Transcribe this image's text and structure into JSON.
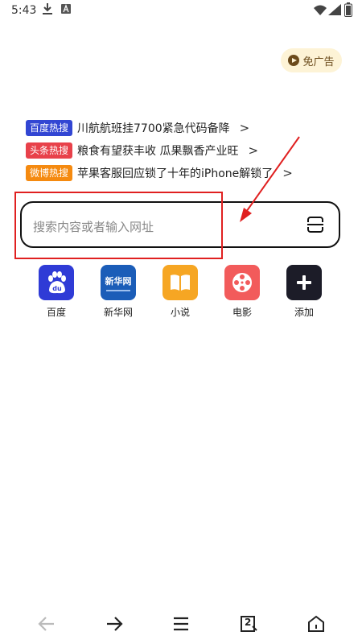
{
  "status_bar": {
    "time": "5:43"
  },
  "ad_free_button": {
    "label": "免广告"
  },
  "hot_searches": [
    {
      "tag": "百度热搜",
      "tag_color": "#3246d3",
      "text": "川航航班挂7700紧急代码备降"
    },
    {
      "tag": "头条热搜",
      "tag_color": "#e8414a",
      "text": "粮食有望获丰收 瓜果飘香产业旺"
    },
    {
      "tag": "微博热搜",
      "tag_color": "#f58a10",
      "text": "苹果客服回应锁了十年的iPhone解锁了"
    }
  ],
  "search": {
    "placeholder": "搜索内容或者输入网址"
  },
  "shortcuts": [
    {
      "label": "百度",
      "icon": "baidu-paw-icon",
      "color": "#2f3bd6"
    },
    {
      "label": "新华网",
      "icon": "xinhua-logo-icon",
      "color": "#1b5db8",
      "logo_text": "新华网"
    },
    {
      "label": "小说",
      "icon": "book-icon",
      "color": "#f6a623"
    },
    {
      "label": "电影",
      "icon": "film-reel-icon",
      "color": "#f25b5b"
    },
    {
      "label": "添加",
      "icon": "plus-icon",
      "color": "#1c1c28"
    }
  ],
  "bottom_nav": [
    "back-arrow-icon",
    "forward-arrow-icon",
    "menu-icon",
    "tabs-count-icon",
    "home-icon"
  ],
  "tabs_count": "2"
}
